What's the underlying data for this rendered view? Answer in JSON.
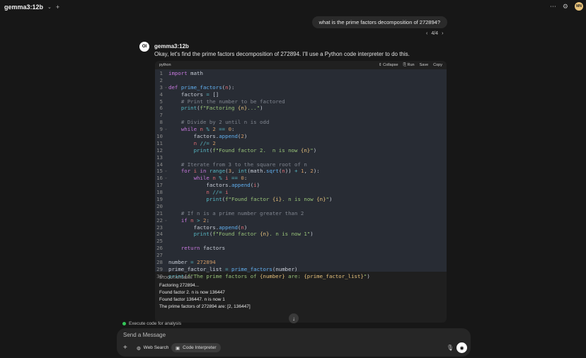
{
  "header": {
    "model": "gemma3:12b",
    "avatar_initials": "MN"
  },
  "user_message": "what is the prime factors decomposition of 272894?",
  "pager": {
    "label": "4/4"
  },
  "bot": {
    "avatar": "OI",
    "name": "gemma3:12b",
    "text": "Okay, let's find the prime factors decomposition of 272894. I'll use a Python code interpreter to do this."
  },
  "code": {
    "language": "python",
    "collapse": "Collapse",
    "run": "Run",
    "save": "Save",
    "copy": "Copy",
    "lines": [
      "import math",
      "",
      "def prime_factors(n):",
      "    factors = []",
      "    # Print the number to be factored",
      "    print(f\"Factoring {n}...\")",
      "",
      "    # Divide by 2 until n is odd",
      "    while n % 2 == 0:",
      "        factors.append(2)",
      "        n //= 2",
      "        print(f\"Found factor 2.  n is now {n}\")",
      "",
      "    # Iterate from 3 to the square root of n",
      "    for i in range(3, int(math.sqrt(n)) + 1, 2):",
      "        while n % i == 0:",
      "            factors.append(i)",
      "            n //= i",
      "            print(f\"Found factor {i}. n is now {n}\")",
      "",
      "    # If n is a prime number greater than 2",
      "    if n > 2:",
      "        factors.append(n)",
      "        print(f\"Found factor {n}. n is now 1\")",
      "",
      "    return factors",
      "",
      "number = 272894",
      "prime_factor_list = prime_factors(number)",
      "print(f\"The prime factors of {number} are: {prime_factor_list}\")"
    ],
    "foldable_lines": [
      3,
      9,
      15,
      16,
      22
    ]
  },
  "output": {
    "label": "STDOUT/STDERR",
    "lines": [
      "Factoring 272894...",
      "Found factor 2. n is now 136447",
      "Found factor 136447. n is now 1",
      "The prime factors of 272894 are: [2, 136447]"
    ]
  },
  "status": "Execute code for analysis",
  "composer": {
    "placeholder": "Send a Message",
    "web_search": "Web Search",
    "code_interpreter": "Code Interpreter"
  },
  "colors": {
    "status_dot": "#34c759",
    "code_bg": "#282c34"
  }
}
